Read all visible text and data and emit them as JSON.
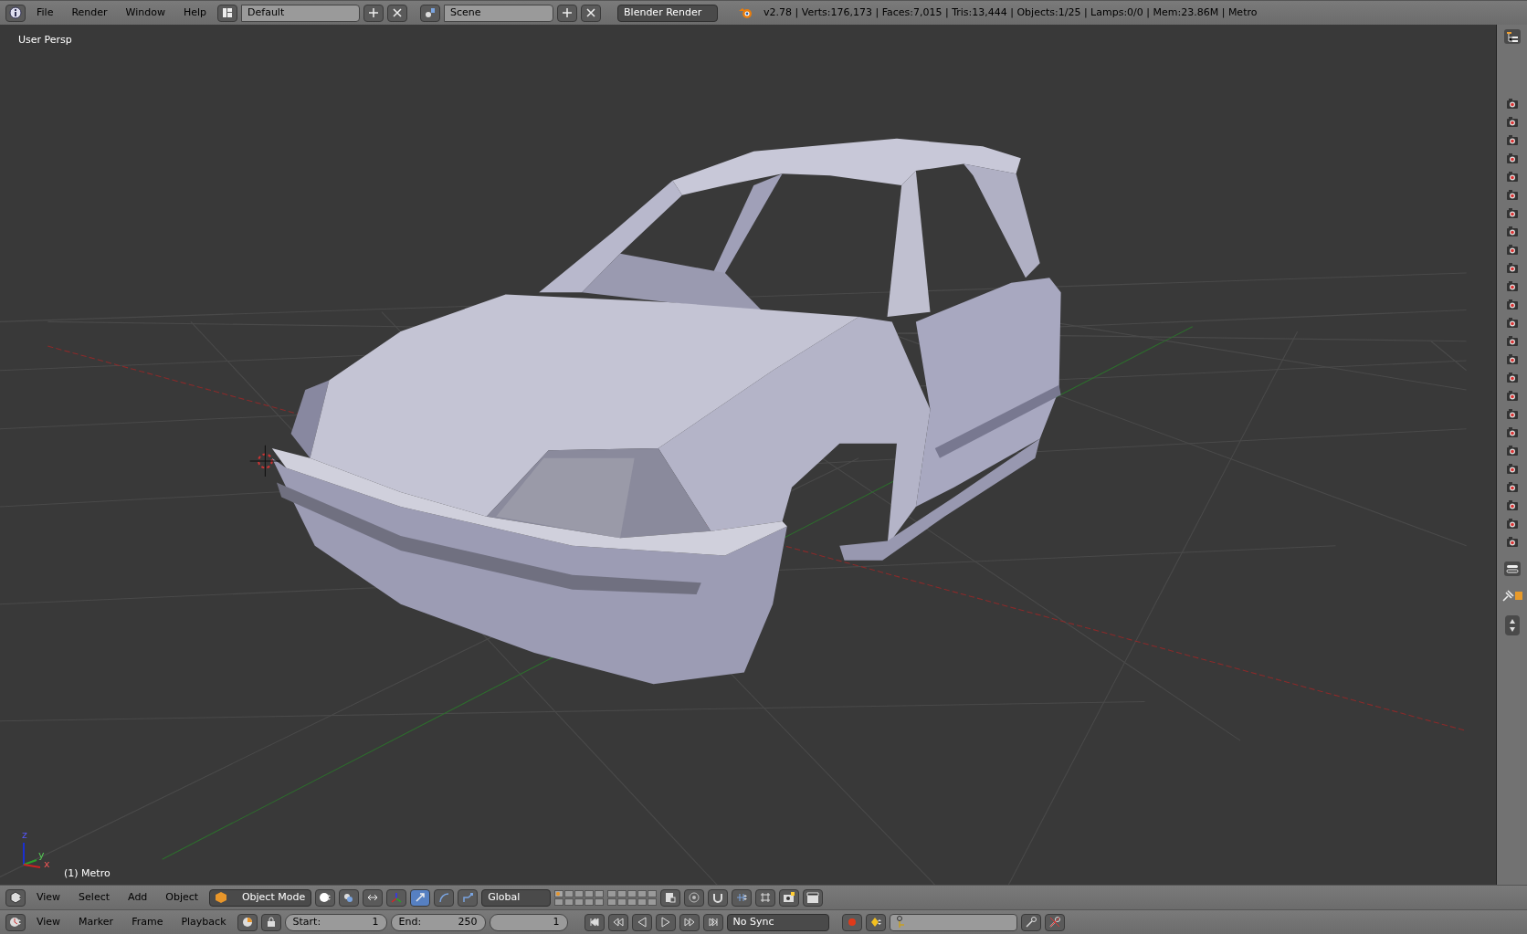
{
  "top_bar": {
    "menus": [
      "File",
      "Render",
      "Window",
      "Help"
    ],
    "layout": "Default",
    "scene": "Scene",
    "render_engine": "Blender Render",
    "stats": "v2.78 | Verts:176,173 | Faces:7,015 | Tris:13,444 | Objects:1/25 | Lamps:0/0 | Mem:23.86M | Metro"
  },
  "viewport": {
    "view_label": "User Persp",
    "object_label": "(1) Metro",
    "axes": [
      "x",
      "y",
      "z"
    ]
  },
  "view3d_header": {
    "menus": [
      "View",
      "Select",
      "Add",
      "Object"
    ],
    "mode": "Object Mode",
    "transform_tools": [
      {
        "kind": "translate",
        "selected": true
      },
      {
        "kind": "rotate",
        "selected": false
      },
      {
        "kind": "scale",
        "selected": false
      }
    ],
    "orientation": "Global",
    "layers": [
      {
        "occupied": true
      },
      {
        "occupied": false
      },
      {
        "occupied": false
      },
      {
        "occupied": false
      },
      {
        "occupied": false
      },
      {
        "occupied": false
      },
      {
        "occupied": false
      },
      {
        "occupied": false
      },
      {
        "occupied": false
      },
      {
        "occupied": false
      },
      {
        "occupied": false
      },
      {
        "occupied": false
      },
      {
        "occupied": false
      },
      {
        "occupied": false
      },
      {
        "occupied": false
      },
      {
        "occupied": false
      },
      {
        "occupied": false
      },
      {
        "occupied": false
      },
      {
        "occupied": false
      },
      {
        "occupied": false
      }
    ]
  },
  "timeline": {
    "menus": [
      "View",
      "Marker",
      "Frame",
      "Playback"
    ],
    "start_label": "Start:",
    "start": "1",
    "end_label": "End:",
    "end": "250",
    "current_frame": "1",
    "sync": "No Sync"
  },
  "outliner": {
    "rows": [
      {
        "renderable": true
      },
      {
        "renderable": true
      },
      {
        "renderable": true
      },
      {
        "renderable": true
      },
      {
        "renderable": true
      },
      {
        "renderable": true
      },
      {
        "renderable": true
      },
      {
        "renderable": true
      },
      {
        "renderable": true
      },
      {
        "renderable": true
      },
      {
        "renderable": true
      },
      {
        "renderable": true
      },
      {
        "renderable": true
      },
      {
        "renderable": true
      },
      {
        "renderable": true
      },
      {
        "renderable": true
      },
      {
        "renderable": true
      },
      {
        "renderable": true
      },
      {
        "renderable": true
      },
      {
        "renderable": true
      },
      {
        "renderable": true
      },
      {
        "renderable": true
      },
      {
        "renderable": true
      },
      {
        "renderable": true
      },
      {
        "renderable": true
      }
    ]
  }
}
